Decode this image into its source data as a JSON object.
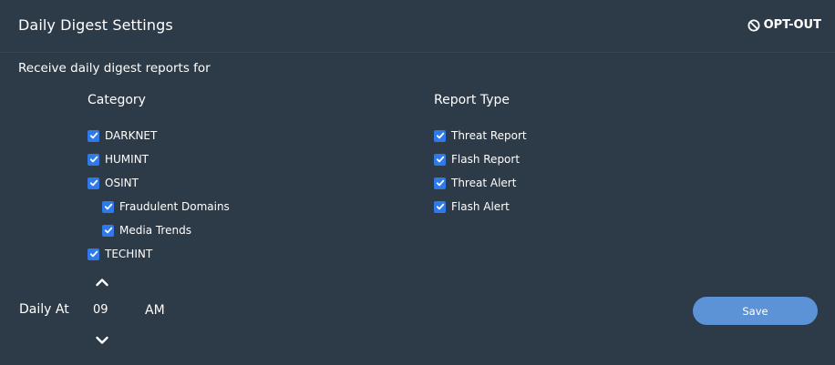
{
  "header": {
    "title": "Daily Digest Settings",
    "optout_label": "OPT-OUT",
    "optout_icon": "block-icon"
  },
  "subtitle": "Receive daily digest reports for",
  "category": {
    "heading": "Category",
    "items": [
      {
        "label": "DARKNET",
        "checked": true,
        "level": 0
      },
      {
        "label": "HUMINT",
        "checked": true,
        "level": 0
      },
      {
        "label": "OSINT",
        "checked": true,
        "level": 0
      },
      {
        "label": "Fraudulent Domains",
        "checked": true,
        "level": 1
      },
      {
        "label": "Media Trends",
        "checked": true,
        "level": 1
      },
      {
        "label": "TECHINT",
        "checked": true,
        "level": 0
      }
    ]
  },
  "report_type": {
    "heading": "Report Type",
    "items": [
      {
        "label": "Threat Report",
        "checked": true
      },
      {
        "label": "Flash Report",
        "checked": true
      },
      {
        "label": "Threat Alert",
        "checked": true
      },
      {
        "label": "Flash Alert",
        "checked": true
      }
    ]
  },
  "schedule": {
    "label": "Daily At",
    "hour": "09",
    "period": "AM"
  },
  "save_label": "Save",
  "colors": {
    "background": "#2d3a47",
    "checkbox": "#2f79e8",
    "save_button": "#5b93d6"
  }
}
